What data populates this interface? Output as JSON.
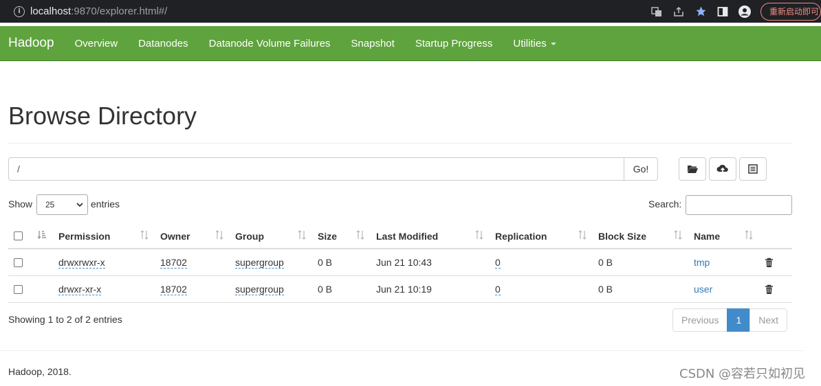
{
  "browser": {
    "url_host": "localhost",
    "url_rest": ":9870/explorer.html#/",
    "relaunch_label": "重新启动即可"
  },
  "navbar": {
    "brand": "Hadoop",
    "items": [
      "Overview",
      "Datanodes",
      "Datanode Volume Failures",
      "Snapshot",
      "Startup Progress",
      "Utilities"
    ]
  },
  "page": {
    "title": "Browse Directory",
    "path_value": "/",
    "go_label": "Go!"
  },
  "table_controls": {
    "show_label": "Show",
    "entries_value": "25",
    "entries_label": "entries",
    "search_label": "Search:"
  },
  "table": {
    "columns": [
      "Permission",
      "Owner",
      "Group",
      "Size",
      "Last Modified",
      "Replication",
      "Block Size",
      "Name"
    ],
    "rows": [
      {
        "permission": "drwxrwxr-x",
        "owner": "18702",
        "group": "supergroup",
        "size": "0 B",
        "modified": "Jun 21 10:43",
        "replication": "0",
        "block_size": "0 B",
        "name": "tmp"
      },
      {
        "permission": "drwxr-xr-x",
        "owner": "18702",
        "group": "supergroup",
        "size": "0 B",
        "modified": "Jun 21 10:19",
        "replication": "0",
        "block_size": "0 B",
        "name": "user"
      }
    ]
  },
  "pagination": {
    "summary": "Showing 1 to 2 of 2 entries",
    "previous": "Previous",
    "current": "1",
    "next": "Next"
  },
  "footer": {
    "text": "Hadoop, 2018.",
    "watermark": "CSDN @容若只如初见"
  },
  "colors": {
    "navbar": "#5fa33e",
    "link": "#337ab7",
    "pager_active": "#428bca"
  }
}
